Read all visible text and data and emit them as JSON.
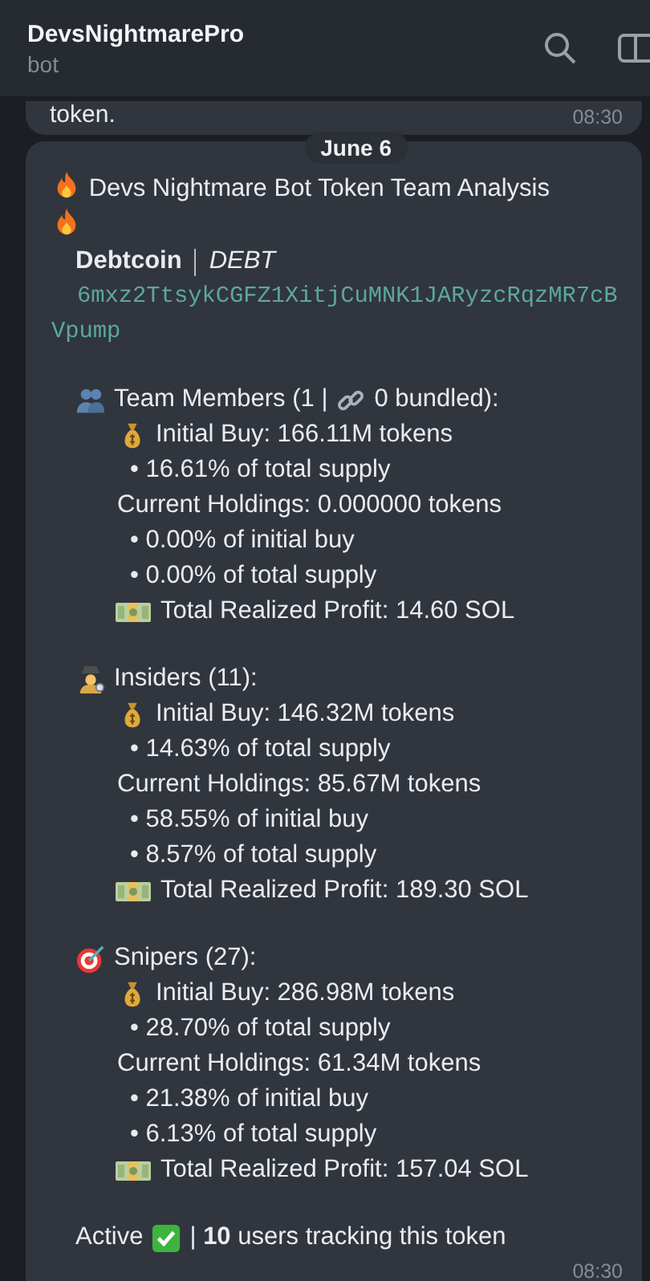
{
  "header": {
    "title": "DevsNightmarePro",
    "subtitle": "bot"
  },
  "previous_message": {
    "text": "token.",
    "time": "08:30"
  },
  "date_separator": "June 6",
  "message": {
    "title": "Devs Nightmare Bot Token Team Analysis",
    "token_name": "Debtcoin",
    "token_symbol": "DEBT",
    "address": "6mxz2TtsykCGFZ1XitjCuMNK1JARyzcRqzMR7cBVpump",
    "sections": [
      {
        "kind": "team",
        "heading": "Team Members (1 |",
        "bundled": "0 bundled):",
        "initial_buy": "Initial Buy: 166.11M tokens",
        "initial_supply": "• 16.61% of total supply",
        "holdings": "Current Holdings: 0.000000 tokens",
        "holdings_initial": "• 0.00% of initial buy",
        "holdings_supply": "• 0.00% of total supply",
        "profit": "Total Realized Profit: 14.60 SOL"
      },
      {
        "kind": "insiders",
        "heading": "Insiders (11):",
        "initial_buy": "Initial Buy: 146.32M tokens",
        "initial_supply": "• 14.63% of total supply",
        "holdings": "Current Holdings: 85.67M tokens",
        "holdings_initial": "• 58.55% of initial buy",
        "holdings_supply": "• 8.57% of total supply",
        "profit": "Total Realized Profit: 189.30 SOL"
      },
      {
        "kind": "snipers",
        "heading": "Snipers (27):",
        "initial_buy": "Initial Buy: 286.98M tokens",
        "initial_supply": "• 28.70% of total supply",
        "holdings": "Current Holdings: 61.34M tokens",
        "holdings_initial": "• 21.38% of initial buy",
        "holdings_supply": "• 6.13% of total supply",
        "profit": "Total Realized Profit: 157.04 SOL"
      }
    ],
    "status": "Active",
    "tracking": "| **10** users tracking this token",
    "time": "08:30"
  }
}
